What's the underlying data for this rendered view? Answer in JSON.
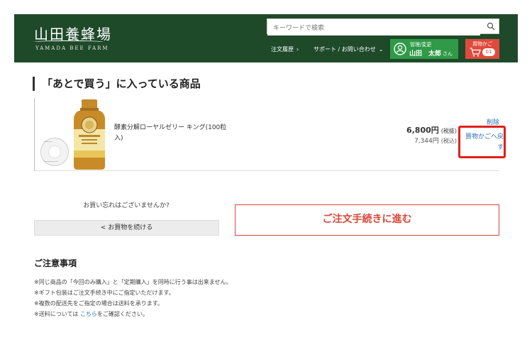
{
  "header": {
    "logo_jp": "山田養蜂場",
    "logo_en": "YAMADA BEE FARM",
    "search": {
      "placeholder": "キーワードで検索"
    },
    "nav": {
      "orders": "注文履歴",
      "support": "サポート / お問い合わせ"
    },
    "member": {
      "label": "管理/変更",
      "name": "山田　太郎",
      "suffix": "さん"
    },
    "cart": {
      "label": "買物かご",
      "count": "01"
    },
    "colors": {
      "header_bg": "#1f4a2a",
      "member_bg": "#2f9a48",
      "cart_bg": "#e04a3c"
    }
  },
  "main": {
    "section_title": "「あとで買う」に入っている商品",
    "item": {
      "name": "酵素分解ローヤルゼリー キング(100粒入)",
      "price_ex": "6,800円",
      "price_ex_label": "(税抜)",
      "price_in": "7,344円",
      "price_in_label": "(税込)",
      "delete_label": "削除",
      "move_label": "買物かごへ戻す"
    },
    "forgot_text": "お買い忘れはございませんか?",
    "continue_label": "< お買物を続ける",
    "checkout_label": "ご注文手続きに進む",
    "notes_title": "ご注意事項",
    "notes": [
      "※同じ商品の「今回のみ購入」と「定期購入」を同時に行う事は出来ません。",
      "※ギフト包装はご注文手続き中にご指定いただけます。",
      "※複数の配送先をご指定の場合は送料を承ります。"
    ],
    "note_shipping_prefix": "※送料については ",
    "note_shipping_link": "こちら",
    "note_shipping_suffix": "をご確認ください。",
    "colors": {
      "checkout": "#d9473a",
      "highlight": "#e0201a",
      "link": "#2a6fb6"
    }
  }
}
